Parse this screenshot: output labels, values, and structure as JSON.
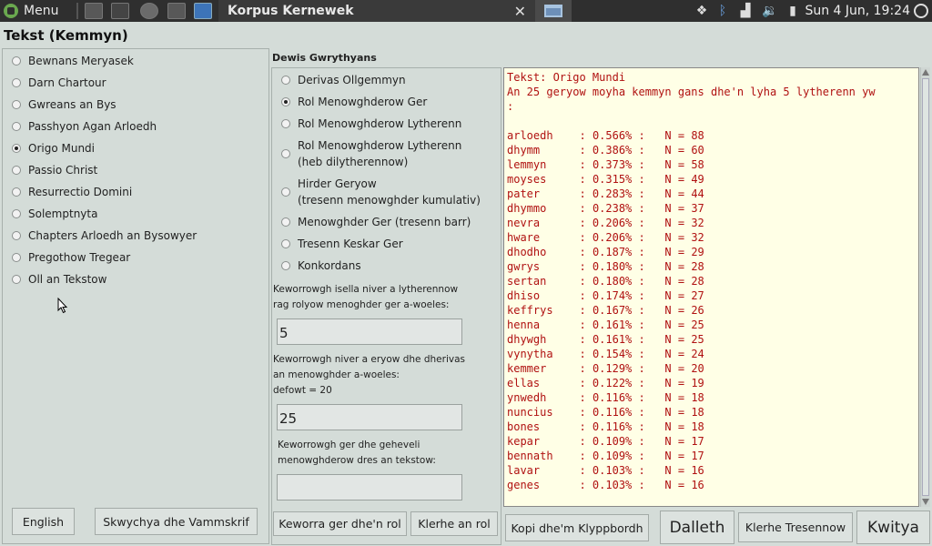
{
  "taskbar": {
    "menu_label": "Menu",
    "active_task": "Korpus Kernewek",
    "close_glyph": "✕",
    "clock": "Sun  4 Jun, 19:24"
  },
  "window": {
    "title": "Tekst (Kemmyn)",
    "middle_heading": "Dewis Gwrythyans"
  },
  "texts": [
    {
      "label": "Bewnans Meryasek",
      "selected": false
    },
    {
      "label": "Darn Chartour",
      "selected": false
    },
    {
      "label": "Gwreans an Bys",
      "selected": false
    },
    {
      "label": "Passhyon Agan Arloedh",
      "selected": false
    },
    {
      "label": "Origo Mundi",
      "selected": true
    },
    {
      "label": "Passio Christ",
      "selected": false
    },
    {
      "label": "Resurrectio Domini",
      "selected": false
    },
    {
      "label": "Solemptnyta",
      "selected": false
    },
    {
      "label": "Chapters Arloedh an Bysowyer",
      "selected": false
    },
    {
      "label": "Pregothow Tregear",
      "selected": false
    },
    {
      "label": "Oll an Tekstow",
      "selected": false
    }
  ],
  "operations": [
    {
      "line1": "Derivas Ollgemmyn",
      "line2": "",
      "selected": false
    },
    {
      "line1": "Rol Menowghderow Ger",
      "line2": "",
      "selected": true
    },
    {
      "line1": "Rol Menowghderow Lytherenn",
      "line2": "",
      "selected": false
    },
    {
      "line1": "Rol Menowghderow Lytherenn",
      "line2": "(heb dilytherennow)",
      "selected": false
    },
    {
      "line1": "Hirder Geryow",
      "line2": "(tresenn menowghder kumulativ)",
      "selected": false
    },
    {
      "line1": "Menowghder Ger (tresenn barr)",
      "line2": "",
      "selected": false
    },
    {
      "line1": "Tresenn Keskar Ger",
      "line2": "",
      "selected": false
    },
    {
      "line1": "Konkordans",
      "line2": "",
      "selected": false
    }
  ],
  "params": {
    "min_letters_label_1": "Keworrowgh isella niver a lytherennow",
    "min_letters_label_2": "rag rolyow menoghder ger a-woeles:",
    "min_letters_value": "5",
    "num_words_label_1": "Keworrowgh niver a eryow dhe dherivas",
    "num_words_label_2": "an menowghder a-woeles:",
    "num_words_label_3": "defowt = 20",
    "num_words_value": "25",
    "word_label_1": "Keworrowgh ger dhe geheveli",
    "word_label_2": "menowghderow dres an tekstow:",
    "word_value": ""
  },
  "buttons": {
    "english": "English",
    "font": "Skwychya dhe Vammskrif",
    "add_word": "Keworra ger dhe'n rol",
    "clear_list": "Klerhe an rol",
    "copy": "Kopi dhe'm Klyppbordh",
    "start": "Dalleth",
    "clear_graphs": "Klerhe Tresennow",
    "quit": "Kwitya"
  },
  "output": {
    "header1": "Tekst: Origo Mundi",
    "header2": "An 25 geryow moyha kemmyn gans dhe'n lyha 5 lytherenn yw",
    "header3": ":",
    "rows": [
      {
        "word": "arloedh",
        "pct": "0.566%",
        "n": "88"
      },
      {
        "word": "dhymm",
        "pct": "0.386%",
        "n": "60"
      },
      {
        "word": "lemmyn",
        "pct": "0.373%",
        "n": "58"
      },
      {
        "word": "moyses",
        "pct": "0.315%",
        "n": "49"
      },
      {
        "word": "pater",
        "pct": "0.283%",
        "n": "44"
      },
      {
        "word": "dhymmo",
        "pct": "0.238%",
        "n": "37"
      },
      {
        "word": "nevra",
        "pct": "0.206%",
        "n": "32"
      },
      {
        "word": "hware",
        "pct": "0.206%",
        "n": "32"
      },
      {
        "word": "dhodho",
        "pct": "0.187%",
        "n": "29"
      },
      {
        "word": "gwrys",
        "pct": "0.180%",
        "n": "28"
      },
      {
        "word": "sertan",
        "pct": "0.180%",
        "n": "28"
      },
      {
        "word": "dhiso",
        "pct": "0.174%",
        "n": "27"
      },
      {
        "word": "keffrys",
        "pct": "0.167%",
        "n": "26"
      },
      {
        "word": "henna",
        "pct": "0.161%",
        "n": "25"
      },
      {
        "word": "dhywgh",
        "pct": "0.161%",
        "n": "25"
      },
      {
        "word": "vynytha",
        "pct": "0.154%",
        "n": "24"
      },
      {
        "word": "kemmer",
        "pct": "0.129%",
        "n": "20"
      },
      {
        "word": "ellas",
        "pct": "0.122%",
        "n": "19"
      },
      {
        "word": "ynwedh",
        "pct": "0.116%",
        "n": "18"
      },
      {
        "word": "nuncius",
        "pct": "0.116%",
        "n": "18"
      },
      {
        "word": "bones",
        "pct": "0.116%",
        "n": "18"
      },
      {
        "word": "kepar",
        "pct": "0.109%",
        "n": "17"
      },
      {
        "word": "bennath",
        "pct": "0.109%",
        "n": "17"
      },
      {
        "word": "lavar",
        "pct": "0.103%",
        "n": "16"
      },
      {
        "word": "genes",
        "pct": "0.103%",
        "n": "16"
      }
    ]
  }
}
